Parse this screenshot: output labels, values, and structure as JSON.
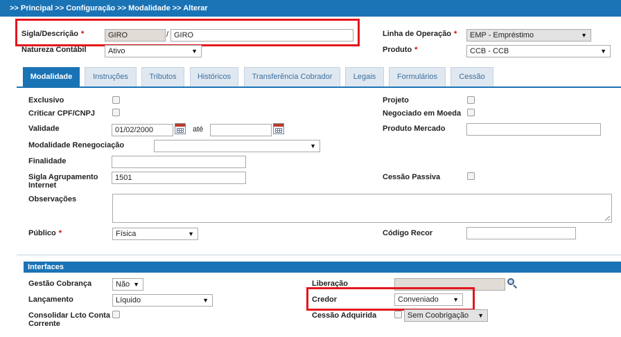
{
  "breadcrumb": ">> Principal >> Configuração >> Modalidade >> Alterar",
  "header": {
    "sigla_label": "Sigla/Descrição",
    "required_mark": "*",
    "sigla_value": "GIRO",
    "separator": "/",
    "descricao_value": "GIRO",
    "natureza_label": "Natureza Contábil",
    "natureza_value": "Ativo",
    "linha_label": "Linha de Operação",
    "linha_value": "EMP - Empréstimo",
    "produto_label": "Produto",
    "produto_value": "CCB - CCB"
  },
  "tabs": [
    {
      "label": "Modalidade",
      "active": true
    },
    {
      "label": "Instruções"
    },
    {
      "label": "Tributos"
    },
    {
      "label": "Históricos"
    },
    {
      "label": "Transferência Cobrador"
    },
    {
      "label": "Legais"
    },
    {
      "label": "Formulários"
    },
    {
      "label": "Cessão"
    }
  ],
  "form": {
    "exclusivo_label": "Exclusivo",
    "criticar_label": "Criticar CPF/CNPJ",
    "validade_label": "Validade",
    "validade_from": "01/02/2000",
    "ate_label": "até",
    "validade_to": "",
    "renegociacao_label": "Modalidade Renegociação",
    "renegociacao_value": "",
    "finalidade_label": "Finalidade",
    "finalidade_value": "",
    "sigla_agrup_label_1": "Sigla Agrupamento",
    "sigla_agrup_label_2": "Internet",
    "sigla_agrup_value": "1501",
    "observacoes_label": "Observações",
    "observacoes_value": "",
    "publico_label": "Público",
    "publico_value": "Física",
    "projeto_label": "Projeto",
    "negociado_label": "Negociado em Moeda",
    "produto_mercado_label": "Produto Mercado",
    "produto_mercado_value": "",
    "cessao_passiva_label": "Cessão Passiva",
    "codigo_recor_label": "Código Recor",
    "codigo_recor_value": ""
  },
  "interfaces": {
    "title": "Interfaces",
    "gestao_label": "Gestão Cobrança",
    "gestao_value": "Não",
    "lancamento_label": "Lançamento",
    "lancamento_value": "Líquido",
    "consolidar_label_1": "Consolidar Lcto Conta",
    "consolidar_label_2": "Corrente",
    "liberacao_label": "Liberação",
    "liberacao_value": "",
    "credor_label": "Credor",
    "credor_value": "Conveniado",
    "cessao_adquirida_label": "Cessão Adquirida",
    "cessao_adquirida_value": "Sem Coobrigação"
  },
  "icons": {
    "dropdown_arrow": "▼",
    "search": "search-icon",
    "calendar": "calendar-icon"
  },
  "colors": {
    "primary": "#1a73b5",
    "highlight": "#e4161c",
    "required": "#d00000"
  }
}
